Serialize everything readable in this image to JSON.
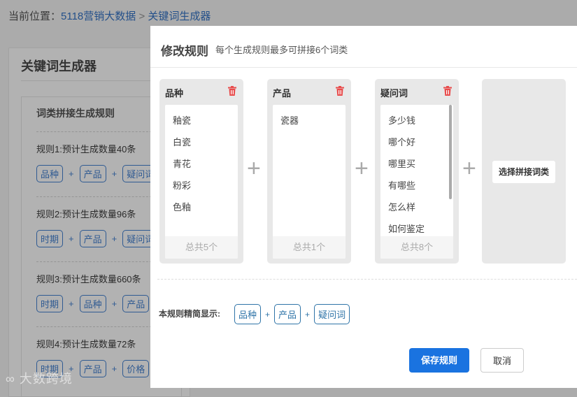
{
  "breadcrumb": {
    "prefix": "当前位置：",
    "home": "5118营销大数据",
    "sep": ">",
    "current": "关键词生成器"
  },
  "card": {
    "title": "关键词生成器",
    "section_title": "词类拼接生成规则",
    "rules": [
      {
        "text": "规则1:预计生成数量40条",
        "tags": [
          "品种",
          "产品",
          "疑问词"
        ]
      },
      {
        "text": "规则2:预计生成数量96条",
        "tags": [
          "时期",
          "产品",
          "疑问词"
        ]
      },
      {
        "text": "规则3:预计生成数量660条",
        "tags": [
          "时期",
          "品种",
          "产品"
        ]
      },
      {
        "text": "规则4:预计生成数量72条",
        "tags": [
          "时期",
          "产品",
          "价格"
        ]
      }
    ],
    "plus": "+"
  },
  "watermark": "大数跨境",
  "modal": {
    "title": "修改规则",
    "subtitle": "每个生成规则最多可拼接6个词类",
    "columns": [
      {
        "name": "品种",
        "items": [
          "釉瓷",
          "白瓷",
          "青花",
          "粉彩",
          "色釉"
        ],
        "total": "总共5个"
      },
      {
        "name": "产品",
        "items": [
          "瓷器"
        ],
        "total": "总共1个"
      },
      {
        "name": "疑问词",
        "items": [
          "多少钱",
          "哪个好",
          "哪里买",
          "有哪些",
          "怎么样",
          "如何鉴定"
        ],
        "total": "总共8个"
      }
    ],
    "plus": "+",
    "choose_label": "选择拼接词类",
    "summary_label": "本规则精简显示:",
    "summary_tags": [
      "品种",
      "产品",
      "疑问词"
    ],
    "save_label": "保存规则",
    "cancel_label": "取消",
    "colors": {
      "primary": "#1a73e0",
      "trash": "#e84c4c"
    }
  }
}
